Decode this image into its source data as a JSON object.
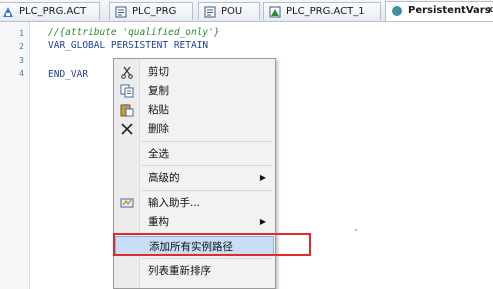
{
  "tabs": [
    {
      "label": "PLC_PRG.ACT",
      "icon": "action-icon",
      "active": false
    },
    {
      "label": "PLC_PRG",
      "icon": "program-icon",
      "active": false
    },
    {
      "label": "POU",
      "icon": "pou-icon",
      "active": false
    },
    {
      "label": "PLC_PRG.ACT_1",
      "icon": "action-icon",
      "active": false
    },
    {
      "label": "PersistentVars",
      "icon": "globe-icon",
      "active": true,
      "close": "x"
    }
  ],
  "editor": {
    "line_numbers": [
      "1",
      "2",
      "3",
      "4"
    ],
    "lines": [
      "//{attribute 'qualified_only'}",
      "VAR_GLOBAL PERSISTENT RETAIN",
      "",
      "END_VAR"
    ]
  },
  "context_menu": {
    "items": [
      {
        "label": "剪切",
        "icon": "scissors-icon"
      },
      {
        "label": "复制",
        "icon": "copy-icon"
      },
      {
        "label": "粘贴",
        "icon": "paste-icon"
      },
      {
        "label": "删除",
        "icon": "delete-icon"
      },
      {
        "label": "全选"
      },
      {
        "label": "高级的",
        "submenu": true
      },
      {
        "label": "输入助手...",
        "icon": "input-assistant-icon"
      },
      {
        "label": "重构",
        "submenu": true
      },
      {
        "label": "添加所有实例路径",
        "highlighted": true
      },
      {
        "label": "列表重新排序"
      }
    ],
    "submenu_arrow": "▶"
  },
  "colors": {
    "highlight_frame": "#e32b2b",
    "hover_bg": "#c9def5",
    "keyword": "#1f3f9f",
    "comment": "#2d8a2d"
  }
}
